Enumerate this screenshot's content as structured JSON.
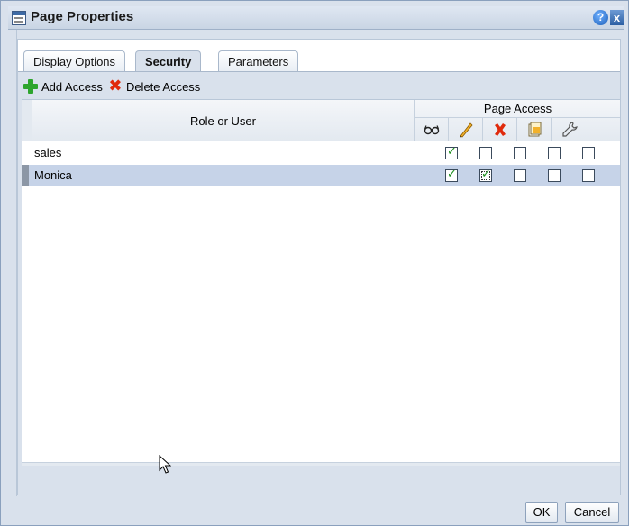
{
  "dialog": {
    "title": "Page Properties",
    "help_glyph": "?",
    "close_glyph": "x"
  },
  "tabs": [
    {
      "label": "Display Options",
      "active": false
    },
    {
      "label": "Security",
      "active": true
    },
    {
      "label": "Parameters",
      "active": false
    }
  ],
  "toolbar": {
    "add_label": "Add Access",
    "delete_label": "Delete Access"
  },
  "table": {
    "col_role": "Role or User",
    "col_access_group": "Page Access",
    "permission_icons": [
      "view-icon",
      "edit-icon",
      "delete-icon",
      "customize-icon",
      "manage-icon"
    ],
    "rows": [
      {
        "name": "sales",
        "selected": false,
        "perms": [
          true,
          false,
          false,
          false,
          false
        ]
      },
      {
        "name": "Monica",
        "selected": true,
        "perms": [
          true,
          true,
          false,
          false,
          false
        ]
      }
    ]
  },
  "footer": {
    "ok_label": "OK",
    "cancel_label": "Cancel"
  },
  "colors": {
    "accent": "#2c5fa3",
    "panel": "#d9e1ec",
    "selected_row": "#c6d3e8",
    "add_green": "#2ea52e",
    "delete_red": "#e02a0c"
  }
}
